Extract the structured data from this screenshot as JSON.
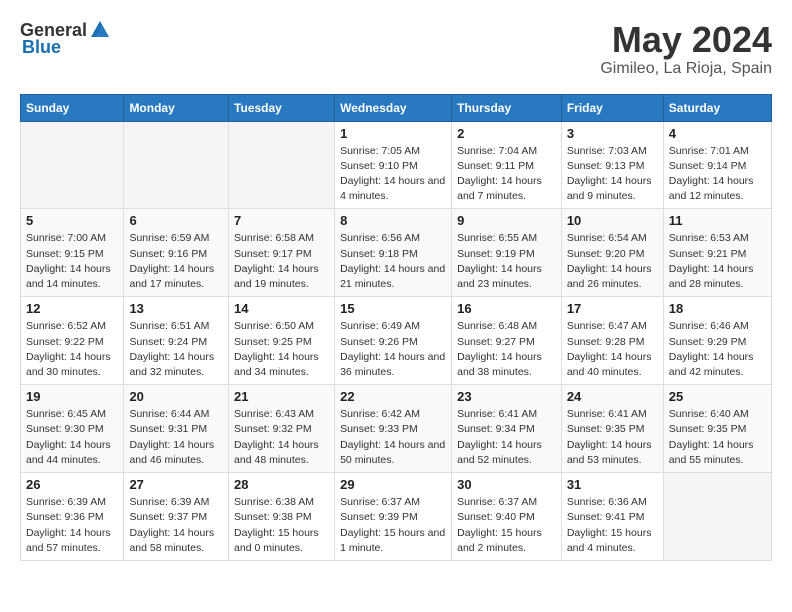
{
  "header": {
    "logo_general": "General",
    "logo_blue": "Blue",
    "title": "May 2024",
    "subtitle": "Gimileo, La Rioja, Spain"
  },
  "days_of_week": [
    "Sunday",
    "Monday",
    "Tuesday",
    "Wednesday",
    "Thursday",
    "Friday",
    "Saturday"
  ],
  "weeks": [
    [
      {
        "num": "",
        "sunrise": "",
        "sunset": "",
        "daylight": ""
      },
      {
        "num": "",
        "sunrise": "",
        "sunset": "",
        "daylight": ""
      },
      {
        "num": "",
        "sunrise": "",
        "sunset": "",
        "daylight": ""
      },
      {
        "num": "1",
        "sunrise": "Sunrise: 7:05 AM",
        "sunset": "Sunset: 9:10 PM",
        "daylight": "Daylight: 14 hours and 4 minutes."
      },
      {
        "num": "2",
        "sunrise": "Sunrise: 7:04 AM",
        "sunset": "Sunset: 9:11 PM",
        "daylight": "Daylight: 14 hours and 7 minutes."
      },
      {
        "num": "3",
        "sunrise": "Sunrise: 7:03 AM",
        "sunset": "Sunset: 9:13 PM",
        "daylight": "Daylight: 14 hours and 9 minutes."
      },
      {
        "num": "4",
        "sunrise": "Sunrise: 7:01 AM",
        "sunset": "Sunset: 9:14 PM",
        "daylight": "Daylight: 14 hours and 12 minutes."
      }
    ],
    [
      {
        "num": "5",
        "sunrise": "Sunrise: 7:00 AM",
        "sunset": "Sunset: 9:15 PM",
        "daylight": "Daylight: 14 hours and 14 minutes."
      },
      {
        "num": "6",
        "sunrise": "Sunrise: 6:59 AM",
        "sunset": "Sunset: 9:16 PM",
        "daylight": "Daylight: 14 hours and 17 minutes."
      },
      {
        "num": "7",
        "sunrise": "Sunrise: 6:58 AM",
        "sunset": "Sunset: 9:17 PM",
        "daylight": "Daylight: 14 hours and 19 minutes."
      },
      {
        "num": "8",
        "sunrise": "Sunrise: 6:56 AM",
        "sunset": "Sunset: 9:18 PM",
        "daylight": "Daylight: 14 hours and 21 minutes."
      },
      {
        "num": "9",
        "sunrise": "Sunrise: 6:55 AM",
        "sunset": "Sunset: 9:19 PM",
        "daylight": "Daylight: 14 hours and 23 minutes."
      },
      {
        "num": "10",
        "sunrise": "Sunrise: 6:54 AM",
        "sunset": "Sunset: 9:20 PM",
        "daylight": "Daylight: 14 hours and 26 minutes."
      },
      {
        "num": "11",
        "sunrise": "Sunrise: 6:53 AM",
        "sunset": "Sunset: 9:21 PM",
        "daylight": "Daylight: 14 hours and 28 minutes."
      }
    ],
    [
      {
        "num": "12",
        "sunrise": "Sunrise: 6:52 AM",
        "sunset": "Sunset: 9:22 PM",
        "daylight": "Daylight: 14 hours and 30 minutes."
      },
      {
        "num": "13",
        "sunrise": "Sunrise: 6:51 AM",
        "sunset": "Sunset: 9:24 PM",
        "daylight": "Daylight: 14 hours and 32 minutes."
      },
      {
        "num": "14",
        "sunrise": "Sunrise: 6:50 AM",
        "sunset": "Sunset: 9:25 PM",
        "daylight": "Daylight: 14 hours and 34 minutes."
      },
      {
        "num": "15",
        "sunrise": "Sunrise: 6:49 AM",
        "sunset": "Sunset: 9:26 PM",
        "daylight": "Daylight: 14 hours and 36 minutes."
      },
      {
        "num": "16",
        "sunrise": "Sunrise: 6:48 AM",
        "sunset": "Sunset: 9:27 PM",
        "daylight": "Daylight: 14 hours and 38 minutes."
      },
      {
        "num": "17",
        "sunrise": "Sunrise: 6:47 AM",
        "sunset": "Sunset: 9:28 PM",
        "daylight": "Daylight: 14 hours and 40 minutes."
      },
      {
        "num": "18",
        "sunrise": "Sunrise: 6:46 AM",
        "sunset": "Sunset: 9:29 PM",
        "daylight": "Daylight: 14 hours and 42 minutes."
      }
    ],
    [
      {
        "num": "19",
        "sunrise": "Sunrise: 6:45 AM",
        "sunset": "Sunset: 9:30 PM",
        "daylight": "Daylight: 14 hours and 44 minutes."
      },
      {
        "num": "20",
        "sunrise": "Sunrise: 6:44 AM",
        "sunset": "Sunset: 9:31 PM",
        "daylight": "Daylight: 14 hours and 46 minutes."
      },
      {
        "num": "21",
        "sunrise": "Sunrise: 6:43 AM",
        "sunset": "Sunset: 9:32 PM",
        "daylight": "Daylight: 14 hours and 48 minutes."
      },
      {
        "num": "22",
        "sunrise": "Sunrise: 6:42 AM",
        "sunset": "Sunset: 9:33 PM",
        "daylight": "Daylight: 14 hours and 50 minutes."
      },
      {
        "num": "23",
        "sunrise": "Sunrise: 6:41 AM",
        "sunset": "Sunset: 9:34 PM",
        "daylight": "Daylight: 14 hours and 52 minutes."
      },
      {
        "num": "24",
        "sunrise": "Sunrise: 6:41 AM",
        "sunset": "Sunset: 9:35 PM",
        "daylight": "Daylight: 14 hours and 53 minutes."
      },
      {
        "num": "25",
        "sunrise": "Sunrise: 6:40 AM",
        "sunset": "Sunset: 9:35 PM",
        "daylight": "Daylight: 14 hours and 55 minutes."
      }
    ],
    [
      {
        "num": "26",
        "sunrise": "Sunrise: 6:39 AM",
        "sunset": "Sunset: 9:36 PM",
        "daylight": "Daylight: 14 hours and 57 minutes."
      },
      {
        "num": "27",
        "sunrise": "Sunrise: 6:39 AM",
        "sunset": "Sunset: 9:37 PM",
        "daylight": "Daylight: 14 hours and 58 minutes."
      },
      {
        "num": "28",
        "sunrise": "Sunrise: 6:38 AM",
        "sunset": "Sunset: 9:38 PM",
        "daylight": "Daylight: 15 hours and 0 minutes."
      },
      {
        "num": "29",
        "sunrise": "Sunrise: 6:37 AM",
        "sunset": "Sunset: 9:39 PM",
        "daylight": "Daylight: 15 hours and 1 minute."
      },
      {
        "num": "30",
        "sunrise": "Sunrise: 6:37 AM",
        "sunset": "Sunset: 9:40 PM",
        "daylight": "Daylight: 15 hours and 2 minutes."
      },
      {
        "num": "31",
        "sunrise": "Sunrise: 6:36 AM",
        "sunset": "Sunset: 9:41 PM",
        "daylight": "Daylight: 15 hours and 4 minutes."
      },
      {
        "num": "",
        "sunrise": "",
        "sunset": "",
        "daylight": ""
      }
    ]
  ]
}
